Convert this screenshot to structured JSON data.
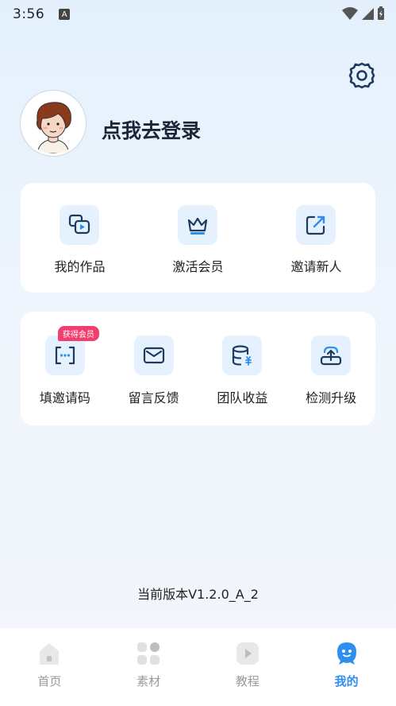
{
  "status_bar": {
    "time": "3:56",
    "notification_icon": "A"
  },
  "profile": {
    "login_text": "点我去登录"
  },
  "menu_top": [
    {
      "label": "我的作品",
      "icon": "gallery-icon"
    },
    {
      "label": "激活会员",
      "icon": "crown-icon"
    },
    {
      "label": "邀请新人",
      "icon": "share-icon"
    }
  ],
  "menu_bottom": [
    {
      "label": "填邀请码",
      "icon": "code-bracket-icon",
      "badge": "获得会员"
    },
    {
      "label": "留言反馈",
      "icon": "mail-icon"
    },
    {
      "label": "团队收益",
      "icon": "database-icon"
    },
    {
      "label": "检测升级",
      "icon": "upload-icon"
    }
  ],
  "version_text": "当前版本V1.2.0_A_2",
  "tabs": [
    {
      "label": "首页",
      "icon": "home-icon",
      "active": false
    },
    {
      "label": "素材",
      "icon": "grid-icon",
      "active": false
    },
    {
      "label": "教程",
      "icon": "play-icon",
      "active": false
    },
    {
      "label": "我的",
      "icon": "person-icon",
      "active": true
    }
  ],
  "colors": {
    "accent": "#2e8ff0",
    "icon_stroke": "#1f3a5f",
    "badge": "#f23e6d",
    "icon_bg": "#e5f1fd"
  }
}
